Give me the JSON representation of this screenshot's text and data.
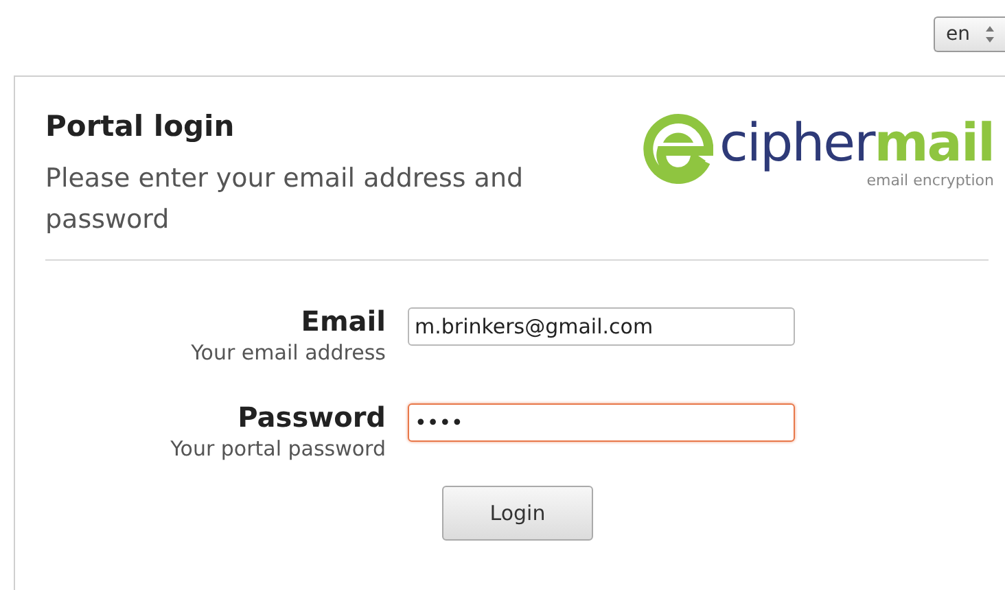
{
  "language_select": {
    "value": "en"
  },
  "panel": {
    "title": "Portal login",
    "subtitle": "Please enter your email address and password",
    "logo": {
      "word_1": "cipher",
      "word_2": "mail",
      "tagline": "email encryption"
    }
  },
  "fields": [
    {
      "label": "Email",
      "hint": "Your email address",
      "value": "m.brinkers@gmail.com",
      "focused": false
    },
    {
      "label": "Password",
      "hint": "Your portal password",
      "value": "••••",
      "focused": true
    }
  ],
  "login_button": "Login"
}
